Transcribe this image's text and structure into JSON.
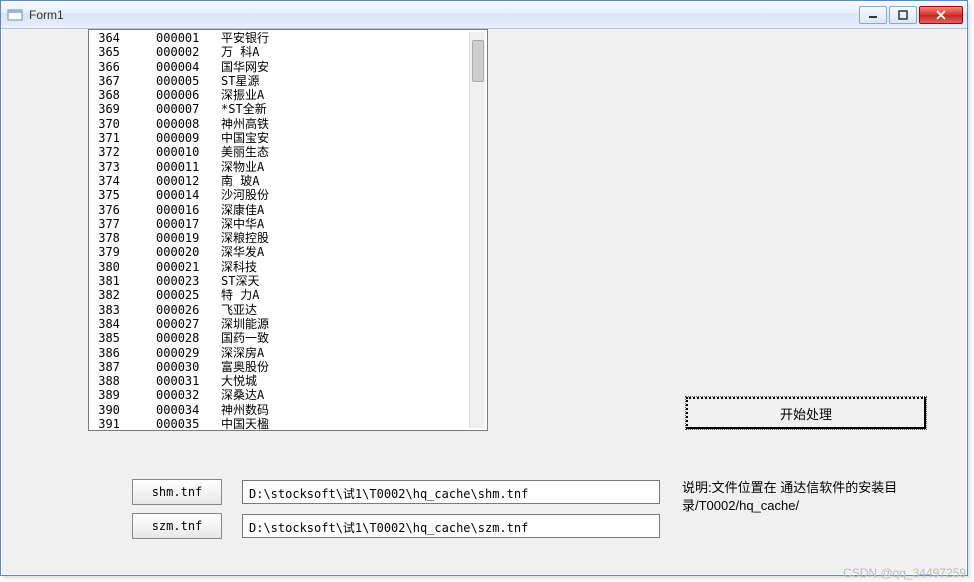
{
  "window": {
    "title": "Form1"
  },
  "listbox": {
    "rows": [
      {
        "idx": "364",
        "code": "000001",
        "name": "平安银行"
      },
      {
        "idx": "365",
        "code": "000002",
        "name": "万 科A"
      },
      {
        "idx": "366",
        "code": "000004",
        "name": "国华网安"
      },
      {
        "idx": "367",
        "code": "000005",
        "name": "ST星源"
      },
      {
        "idx": "368",
        "code": "000006",
        "name": "深振业A"
      },
      {
        "idx": "369",
        "code": "000007",
        "name": "*ST全新"
      },
      {
        "idx": "370",
        "code": "000008",
        "name": "神州高铁"
      },
      {
        "idx": "371",
        "code": "000009",
        "name": "中国宝安"
      },
      {
        "idx": "372",
        "code": "000010",
        "name": "美丽生态"
      },
      {
        "idx": "373",
        "code": "000011",
        "name": "深物业A"
      },
      {
        "idx": "374",
        "code": "000012",
        "name": "南 玻A"
      },
      {
        "idx": "375",
        "code": "000014",
        "name": "沙河股份"
      },
      {
        "idx": "376",
        "code": "000016",
        "name": "深康佳A"
      },
      {
        "idx": "377",
        "code": "000017",
        "name": "深中华A"
      },
      {
        "idx": "378",
        "code": "000019",
        "name": "深粮控股"
      },
      {
        "idx": "379",
        "code": "000020",
        "name": "深华发A"
      },
      {
        "idx": "380",
        "code": "000021",
        "name": "深科技"
      },
      {
        "idx": "381",
        "code": "000023",
        "name": "ST深天"
      },
      {
        "idx": "382",
        "code": "000025",
        "name": "特 力A"
      },
      {
        "idx": "383",
        "code": "000026",
        "name": "飞亚达"
      },
      {
        "idx": "384",
        "code": "000027",
        "name": "深圳能源"
      },
      {
        "idx": "385",
        "code": "000028",
        "name": "国药一致"
      },
      {
        "idx": "386",
        "code": "000029",
        "name": "深深房A"
      },
      {
        "idx": "387",
        "code": "000030",
        "name": "富奥股份"
      },
      {
        "idx": "388",
        "code": "000031",
        "name": "大悦城"
      },
      {
        "idx": "389",
        "code": "000032",
        "name": "深桑达A"
      },
      {
        "idx": "390",
        "code": "000034",
        "name": "神州数码"
      },
      {
        "idx": "391",
        "code": "000035",
        "name": "中国天楹"
      }
    ]
  },
  "buttons": {
    "start": "开始处理",
    "shm": "shm.tnf",
    "szm": "szm.tnf"
  },
  "paths": {
    "shm": "D:\\stocksoft\\试1\\T0002\\hq_cache\\shm.tnf",
    "szm": "D:\\stocksoft\\试1\\T0002\\hq_cache\\szm.tnf"
  },
  "note": "说明:文件位置在       通达信软件的安装目录/T0002/hq_cache/",
  "watermark": "CSDN @qq_34497259"
}
